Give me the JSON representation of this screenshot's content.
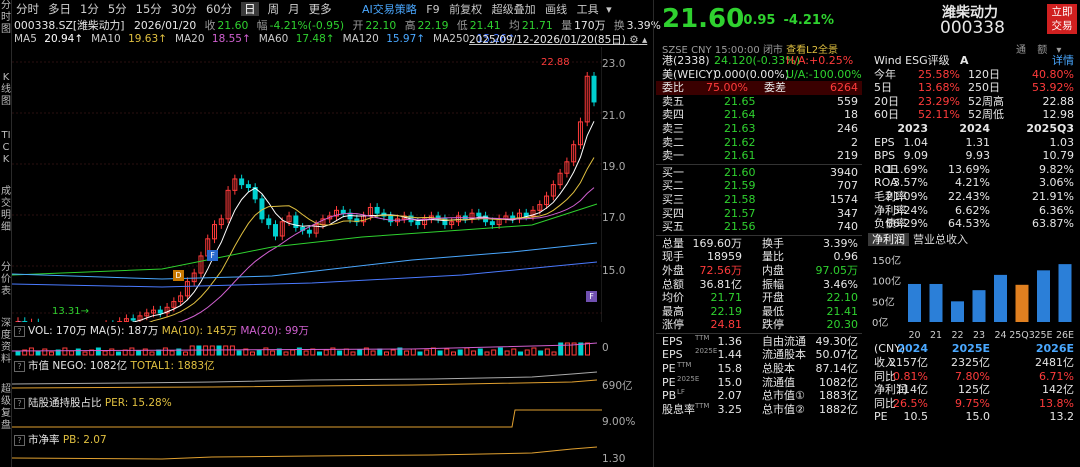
{
  "left_strip": [
    "分时图",
    "K线图",
    "TICK",
    "成交明细",
    "分价表",
    "深度资料",
    "超级复盘"
  ],
  "timeframes": [
    "分时",
    "多日",
    "1分",
    "5分",
    "15分",
    "30分",
    "60分",
    "日",
    "周",
    "月",
    "更多"
  ],
  "selected_tf": "日",
  "toolbar": {
    "ai": "AI交易策略",
    "f9": "F9",
    "fuquan": "前复权",
    "overlay": "超级叠加",
    "draw": "画线",
    "tools": "工具"
  },
  "info": {
    "code": "000338.SZ[潍柴动力]",
    "date": "2026/01/20",
    "close_label": "收",
    "close": "21.60",
    "chg_label": "幅",
    "chg": "-4.21%(-0.95)",
    "open_label": "开",
    "open": "22.10",
    "high_label": "高",
    "high": "22.19",
    "low_label": "低",
    "low": "21.41",
    "avg_label": "均",
    "avg": "21.71",
    "vol_label": "量",
    "vol": "170万",
    "turn_label": "换",
    "turn": "3.39%"
  },
  "ma": [
    {
      "label": "MA5",
      "value": "20.94",
      "color": "#ffffff"
    },
    {
      "label": "MA10",
      "value": "19.63",
      "color": "#e0c040"
    },
    {
      "label": "MA20",
      "value": "18.55",
      "color": "#d060d0"
    },
    {
      "label": "MA60",
      "value": "17.48",
      "color": "#2fd12f"
    },
    {
      "label": "MA120",
      "value": "15.97",
      "color": "#4aa8ff"
    },
    {
      "label": "MA250",
      "value": "15.26",
      "color": "#4a7aff"
    }
  ],
  "range": "2025/09/12-2026/01/20(85日)",
  "y_axis": [
    "23.0",
    "21.0",
    "19.0",
    "17.0",
    "15.0"
  ],
  "price_hi": "22.88",
  "price_lo": "13.31",
  "vol_label": "VOL: 170万",
  "vol_ma5": "MA(5): 187万",
  "vol_ma10": "MA(10): 145万",
  "vol_ma20": "MA(20): 99万",
  "vol_axis": "0",
  "mv_label": "市值",
  "mv_nego": "NEGO: 1082亿",
  "mv_total": "TOTAL1: 1883亿",
  "mv_axis": "690亿",
  "hk_label": "陆股通持股占比",
  "hk_per": "PER: 15.28%",
  "hk_axis": "9.00%",
  "pb_label": "市净率",
  "pb_val": "PB: 2.07",
  "pb_axis": "1.30",
  "quote": {
    "price": "21.60",
    "chg": "-0.95",
    "pct": "-4.21%",
    "name": "潍柴动力",
    "code": "000338",
    "btn": "立即交易",
    "exch": "SZSE",
    "cur": "CNY",
    "time": "15:00:00",
    "status": "闭市",
    "l2": "查看L2全景",
    "tongban": "通",
    "tongban2": "额"
  },
  "h_port": {
    "label": "港(2338)",
    "val": "24.120(-0.33%)",
    "ha": "H/A:+0.25%"
  },
  "us_port": {
    "label": "美(WEICY)",
    "val": "0.000(0.00%)",
    "ua": "U/A:-100.00%"
  },
  "weibi": {
    "l": "委比",
    "v": "75.00%",
    "l2": "委差",
    "v2": "6264"
  },
  "sells": [
    {
      "l": "卖五",
      "p": "21.65",
      "v": "559"
    },
    {
      "l": "卖四",
      "p": "21.64",
      "v": "18"
    },
    {
      "l": "卖三",
      "p": "21.63",
      "v": "246"
    },
    {
      "l": "卖二",
      "p": "21.62",
      "v": "2"
    },
    {
      "l": "卖一",
      "p": "21.61",
      "v": "219"
    }
  ],
  "buys": [
    {
      "l": "买一",
      "p": "21.60",
      "v": "3940"
    },
    {
      "l": "买二",
      "p": "21.59",
      "v": "707"
    },
    {
      "l": "买三",
      "p": "21.58",
      "v": "1574"
    },
    {
      "l": "买四",
      "p": "21.57",
      "v": "347"
    },
    {
      "l": "买五",
      "p": "21.56",
      "v": "740"
    }
  ],
  "stats": [
    {
      "l": "总量",
      "v": "169.60万",
      "l2": "换手",
      "v2": "3.39%",
      "c": "wh",
      "c2": "wh"
    },
    {
      "l": "现手",
      "v": "18959",
      "l2": "量比",
      "v2": "0.96",
      "c": "wh",
      "c2": "wh"
    },
    {
      "l": "外盘",
      "v": "72.56万",
      "l2": "内盘",
      "v2": "97.05万",
      "c": "up",
      "c2": "dn"
    },
    {
      "l": "总额",
      "v": "36.81亿",
      "l2": "振幅",
      "v2": "3.46%",
      "c": "wh",
      "c2": "wh"
    },
    {
      "l": "均价",
      "v": "21.71",
      "l2": "开盘",
      "v2": "22.10",
      "c": "dn",
      "c2": "dn"
    },
    {
      "l": "最高",
      "v": "22.19",
      "l2": "最低",
      "v2": "21.41",
      "c": "dn",
      "c2": "dn"
    },
    {
      "l": "涨停",
      "v": "24.81",
      "l2": "跌停",
      "v2": "20.30",
      "c": "up",
      "c2": "dn"
    }
  ],
  "fund": [
    {
      "l": "EPS",
      "s": "TTM",
      "v": "1.36",
      "l2": "自由流通",
      "v2": "49.30亿"
    },
    {
      "l": "EPS",
      "s": "2025E",
      "v": "1.44",
      "l2": "流通股本",
      "v2": "50.07亿"
    },
    {
      "l": "PE",
      "s": "TTM",
      "v": "15.8",
      "l2": "总股本",
      "v2": "87.14亿"
    },
    {
      "l": "PE",
      "s": "2025E",
      "v": "15.0",
      "l2": "流通值",
      "v2": "1082亿"
    },
    {
      "l": "PB",
      "s": "LF",
      "v": "2.07",
      "l2": "总市值",
      "s2": "①",
      "v2": "1883亿"
    },
    {
      "l": "股息率",
      "s": "TTM",
      "v": "3.25",
      "l2": "总市值",
      "s2": "②",
      "v2": "1882亿"
    }
  ],
  "esg": {
    "label": "Wind ESG评级",
    "grade": "A",
    "detail": "详情"
  },
  "perf": [
    {
      "l": "今年",
      "v": "25.58%",
      "l2": "120日",
      "v2": "40.80%",
      "c2": "up"
    },
    {
      "l": "5日",
      "v": "13.68%",
      "l2": "250日",
      "v2": "53.92%",
      "c2": "up"
    },
    {
      "l": "20日",
      "v": "23.29%",
      "l2": "52周高",
      "v2": "22.88",
      "c2": "wh"
    },
    {
      "l": "60日",
      "v": "52.11%",
      "l2": "52周低",
      "v2": "12.98",
      "c2": "wh"
    }
  ],
  "fin_years": [
    "2023",
    "2024",
    "2025Q3"
  ],
  "fin": [
    {
      "l": "EPS",
      "v": [
        "1.04",
        "1.31",
        "1.03"
      ]
    },
    {
      "l": "BPS",
      "v": [
        "9.09",
        "9.93",
        "10.79"
      ]
    },
    {
      "l": "ROE",
      "v": [
        "11.69%",
        "13.69%",
        "9.82%"
      ]
    },
    {
      "l": "ROA",
      "v": [
        "3.57%",
        "4.21%",
        "3.06%"
      ]
    },
    {
      "l": "毛利率",
      "v": [
        "21.09%",
        "22.43%",
        "21.91%"
      ]
    },
    {
      "l": "净利率",
      "v": [
        "5.24%",
        "6.62%",
        "6.36%"
      ]
    },
    {
      "l": "负债率",
      "v": [
        "66.29%",
        "64.53%",
        "63.87%"
      ]
    }
  ],
  "tabs": {
    "t1": "净利润",
    "t2": "营业总收入"
  },
  "bar_axis": [
    "150亿",
    "100亿",
    "50亿",
    "0亿"
  ],
  "bar_x": [
    "20",
    "21",
    "22",
    "23",
    "24",
    "25Q3",
    "25E",
    "26E"
  ],
  "bar_vals": [
    92,
    92,
    50,
    77,
    114,
    90,
    125,
    140
  ],
  "fc_head": [
    "(CNY)",
    "2024",
    "2025E",
    "2026E"
  ],
  "fc": [
    {
      "l": "收入",
      "v": [
        "2157亿",
        "2325亿",
        "2481亿"
      ],
      "c": "wh"
    },
    {
      "l": "同比",
      "v": [
        "0.81%",
        "7.80%",
        "6.71%"
      ],
      "c": "up"
    },
    {
      "l": "净利润",
      "v": [
        "114亿",
        "125亿",
        "142亿"
      ],
      "c": "wh"
    },
    {
      "l": "同比",
      "v": [
        "26.5%",
        "9.75%",
        "13.8%"
      ],
      "c": "up"
    },
    {
      "l": "PE",
      "v": [
        "10.5",
        "15.0",
        "13.2"
      ],
      "c": "wh"
    }
  ]
}
